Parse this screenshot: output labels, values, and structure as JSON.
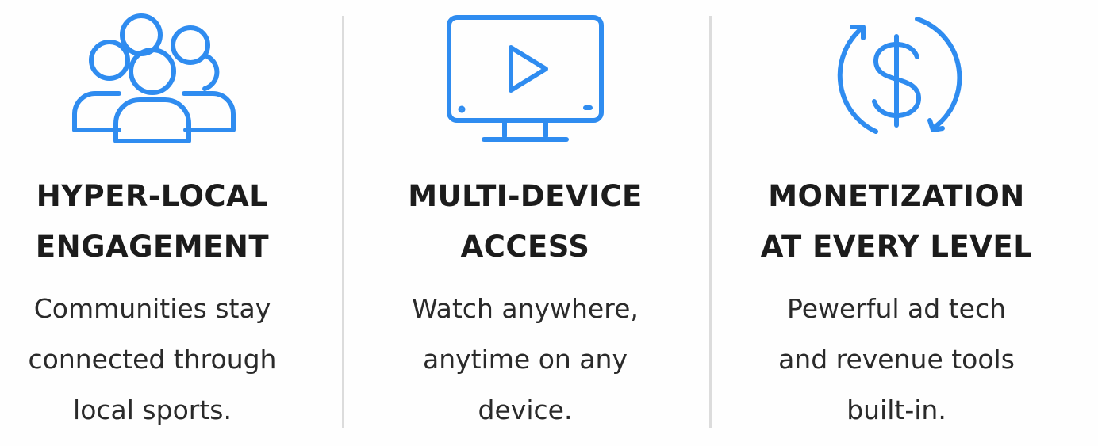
{
  "theme": {
    "accent": "#2f8cf0",
    "text": "#1c1c1c",
    "divider": "#dcdcdc"
  },
  "features": [
    {
      "icon": "community-group-icon",
      "title_lines": [
        "HYPER-LOCAL",
        "ENGAGEMENT"
      ],
      "description_lines": [
        "Communities stay",
        "connected through",
        "local sports."
      ]
    },
    {
      "icon": "monitor-play-icon",
      "title_lines": [
        "MULTI-DEVICE",
        "ACCESS"
      ],
      "description_lines": [
        "Watch anywhere,",
        "anytime on any",
        "device."
      ]
    },
    {
      "icon": "dollar-cycle-icon",
      "title_lines": [
        "MONETIZATION",
        "AT EVERY LEVEL"
      ],
      "description_lines": [
        "Pewerful ad tech",
        "and revenue tools",
        "built-in."
      ]
    }
  ]
}
